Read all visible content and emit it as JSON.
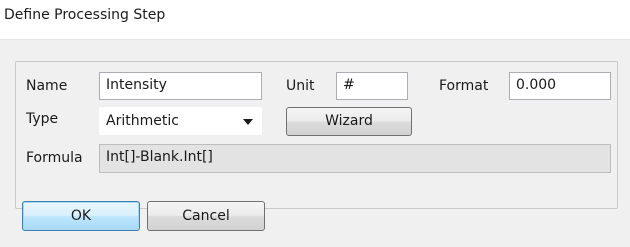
{
  "window": {
    "title": "Define Processing Step"
  },
  "fields": {
    "name_label": "Name",
    "name_value": "Intensity",
    "unit_label": "Unit",
    "unit_value": "#",
    "format_label": "Format",
    "format_value": "0.000",
    "type_label": "Type",
    "type_value": "Arithmetic",
    "wizard_label": "Wizard",
    "formula_label": "Formula",
    "formula_value": "Int[]-Blank.Int[]"
  },
  "buttons": {
    "ok": "OK",
    "cancel": "Cancel"
  },
  "icons": {
    "type_dropdown": "chevron-down-icon"
  }
}
